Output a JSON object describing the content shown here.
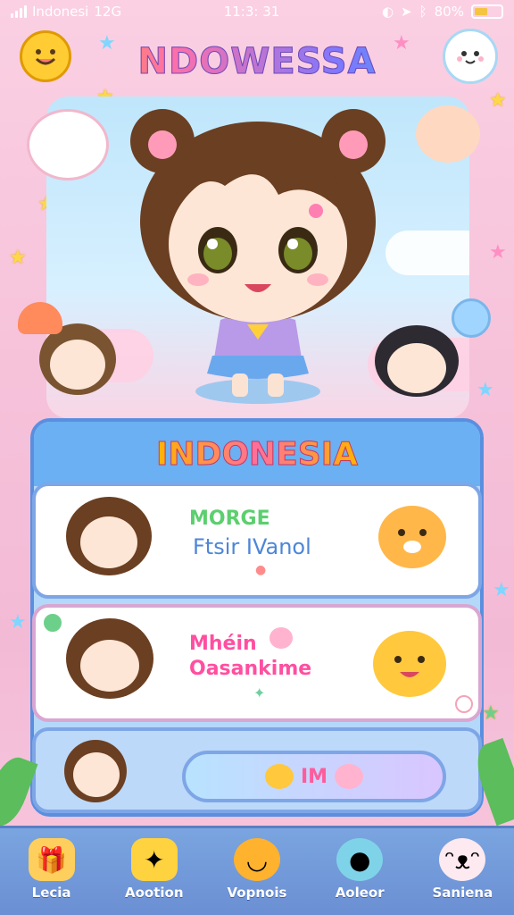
{
  "status": {
    "carrier": "Indonesi",
    "network": "12G",
    "time": "11:3: 31",
    "battery": "80%"
  },
  "app": {
    "title": "NDOWESSA"
  },
  "panel": {
    "title": "INDONESIA"
  },
  "cards": [
    {
      "line1": "MORGE",
      "line2": "Ftsir IVanol",
      "line1_color": "#5ccf6e",
      "line2_color": "#4e86d8"
    },
    {
      "line1": "Mhéin",
      "line2": "Oasankime",
      "line1_color": "#ff4fa0",
      "line2_color": "#ff4fa0"
    }
  ],
  "action": {
    "label": "IM"
  },
  "nav": [
    {
      "label": "Lecia",
      "icon": "gift-box-icon"
    },
    {
      "label": "Aootion",
      "icon": "yellow-creature-icon"
    },
    {
      "label": "Vopnois",
      "icon": "orange-ball-icon"
    },
    {
      "label": "Aoleor",
      "icon": "globe-icon"
    },
    {
      "label": "Saniena",
      "icon": "bunny-icon"
    }
  ],
  "colors": {
    "accent": "#5a8fe0",
    "pink": "#ff4fa0",
    "background": "#f7c9de"
  }
}
